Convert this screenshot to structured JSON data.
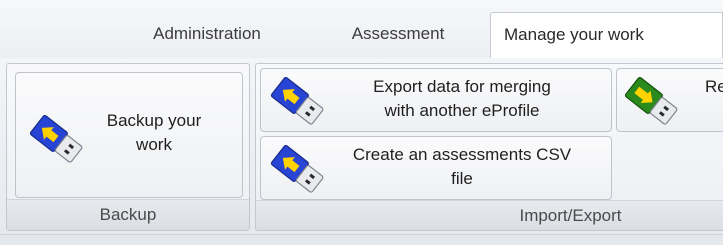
{
  "tabs": {
    "administration": "Administration",
    "assessment": "Assessment",
    "manage": "Manage your work"
  },
  "groups": {
    "backup": {
      "label": "Backup",
      "button_line1": "Backup your",
      "button_line2": "work",
      "icon": "usb-upload-icon"
    },
    "import_export": {
      "label": "Import/Export",
      "export_line1": "Export data for merging",
      "export_line2": "with another eProfile",
      "csv_line1": "Create an assessments CSV",
      "csv_line2": "file",
      "re_label": "Re",
      "icons": [
        "usb-upload-icon",
        "usb-upload-icon",
        "usb-download-icon"
      ]
    }
  },
  "colors": {
    "upload_arrow_bg": "#1e3fd0",
    "upload_arrow": "#ffd200",
    "download_arrow_bg": "#2a8a1e",
    "download_arrow": "#ffd200"
  }
}
